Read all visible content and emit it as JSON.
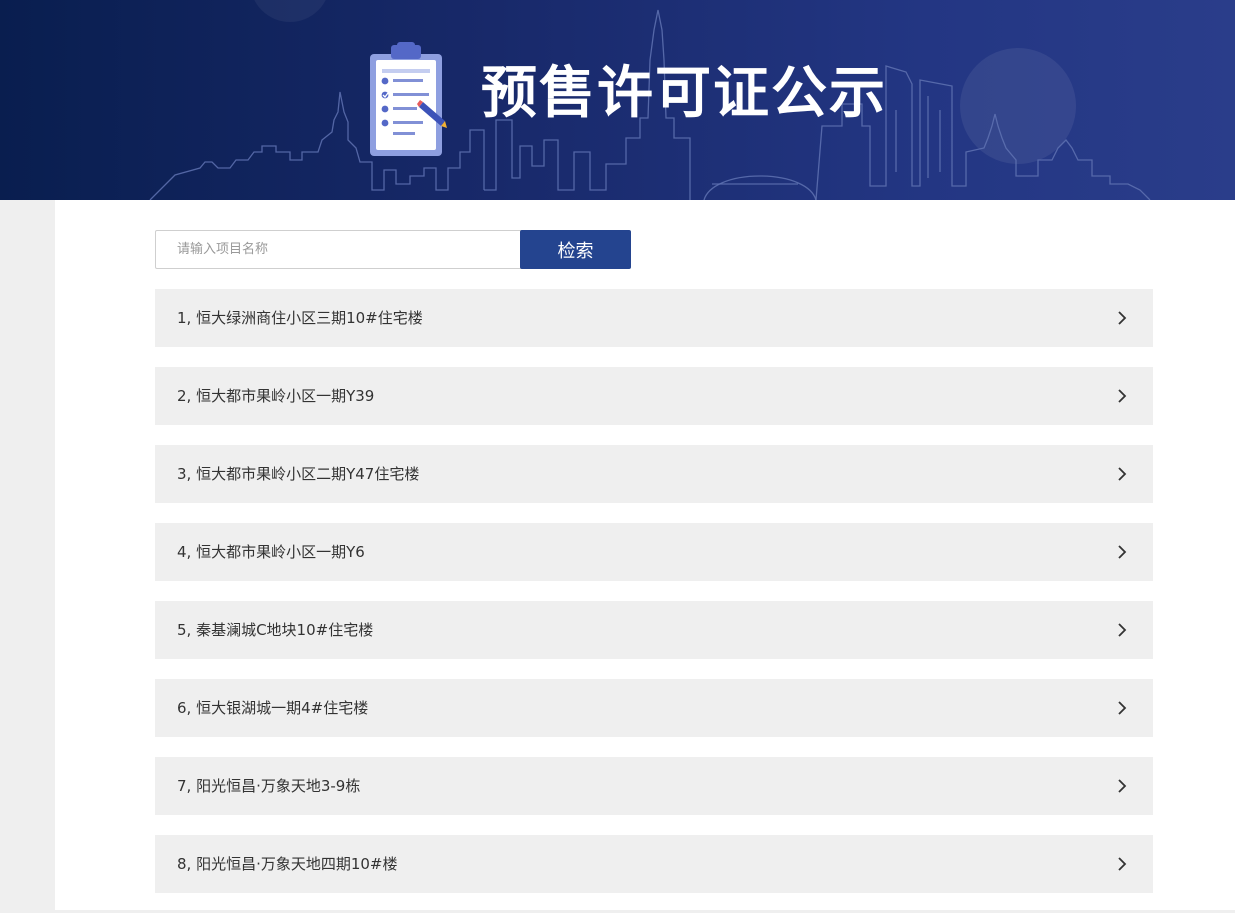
{
  "banner": {
    "title": "预售许可证公示",
    "icons": [
      "clipboard-checklist-icon",
      "pen-icon"
    ],
    "skyline": "city-skyline-outline",
    "colors": {
      "gradient_start": "#091e4f",
      "gradient_end": "#2a3d8a",
      "title": "#ffffff"
    }
  },
  "search": {
    "placeholder": "请输入项目名称",
    "value": "",
    "button_label": "检索",
    "button_color": "#24448f"
  },
  "list": {
    "background": "#efefef",
    "chevron_icon": "chevron-right-icon",
    "items": [
      {
        "label": "1, 恒大绿洲商住小区三期10#住宅楼"
      },
      {
        "label": "2, 恒大都市果岭小区一期Y39"
      },
      {
        "label": "3, 恒大都市果岭小区二期Y47住宅楼"
      },
      {
        "label": "4, 恒大都市果岭小区一期Y6"
      },
      {
        "label": "5, 秦基澜城C地块10#住宅楼"
      },
      {
        "label": "6, 恒大银湖城一期4#住宅楼"
      },
      {
        "label": "7, 阳光恒昌·万象天地3-9栋"
      },
      {
        "label": "8, 阳光恒昌·万象天地四期10#楼"
      }
    ]
  }
}
